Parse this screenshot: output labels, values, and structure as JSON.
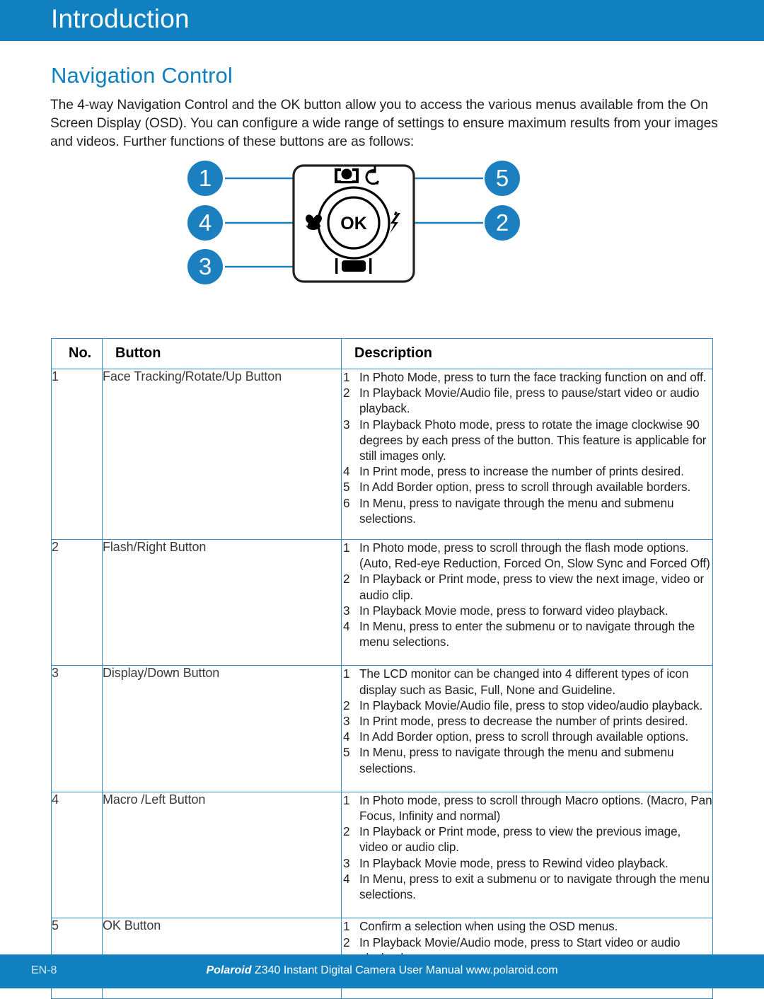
{
  "header": {
    "title": "Introduction",
    "bar_color": "#1180c0"
  },
  "section": {
    "heading": "Navigation Control",
    "heading_color": "#1180c0",
    "paragraph": "The 4-way Navigation Control and the OK button allow you to access the various menus available from the On Screen Display (OSD). You can configure a wide range of settings to ensure maximum results from your images and videos. Further functions of these buttons are as follows:"
  },
  "diagram": {
    "name": "navigation-control-pad-diagram",
    "accent_color": "#1b7fc0",
    "callouts": [
      {
        "label": "1",
        "side": "left",
        "target": "face-tracking-rotate-up-button"
      },
      {
        "label": "4",
        "side": "left",
        "target": "macro-left-button"
      },
      {
        "label": "3",
        "side": "left",
        "target": "display-down-button"
      },
      {
        "label": "5",
        "side": "right",
        "target": "ok-button"
      },
      {
        "label": "2",
        "side": "right",
        "target": "flash-right-button"
      }
    ],
    "pad_icons": {
      "ok": "OK",
      "up": "face-tracking-icon",
      "up_secondary": "self-timer-rotate-icon",
      "left": "macro-flower-icon",
      "right": "flash-bolt-icon",
      "down": "display-screen-icon"
    }
  },
  "table": {
    "columns": [
      "No.",
      "Button",
      "Description"
    ],
    "rows": [
      {
        "no": "1",
        "button": "Face Tracking/Rotate/Up Button",
        "descriptions": [
          "In Photo Mode, press to turn the face tracking function on and off.",
          "In Playback Movie/Audio file, press to pause/start video or audio playback.",
          "In Playback Photo mode, press to rotate the image clockwise 90 degrees by each press of the button. This feature is applicable for still images only.",
          "In Print mode, press to increase the number of prints desired.",
          "In Add Border option, press to scroll through available borders.",
          "In Menu, press to navigate through the menu and submenu selections."
        ]
      },
      {
        "no": "2",
        "button": "Flash/Right Button",
        "descriptions": [
          "In Photo mode, press to scroll through the flash mode options. (Auto, Red-eye Reduction, Forced On, Slow Sync and Forced Off)",
          "In Playback or Print mode, press to view the next image, video or audio clip.",
          "In Playback Movie mode, press to forward video playback.",
          "In Menu, press to enter the submenu or to navigate through the menu selections."
        ]
      },
      {
        "no": "3",
        "button": "Display/Down Button",
        "descriptions": [
          "The LCD monitor can be changed into 4 different types of icon display such as Basic, Full, None and Guideline.",
          "In Playback Movie/Audio file, press to stop video/audio playback.",
          "In Print mode, press to decrease the number of prints desired.",
          "In Add Border option, press to scroll through available options.",
          "In Menu, press to navigate through the menu and submenu selections."
        ]
      },
      {
        "no": "4",
        "button": "Macro /Left Button",
        "descriptions": [
          "In Photo mode, press to scroll through Macro options. (Macro, Pan Focus, Infinity and normal)",
          "In Playback or Print mode, press to view the previous image, video or audio clip.",
          "In Playback Movie mode, press to Rewind video playback.",
          "In Menu, press to exit a submenu or to navigate through the menu selections."
        ]
      },
      {
        "no": "5",
        "button": "OK Button",
        "descriptions": [
          "Confirm a selection when using the OSD menus.",
          "In Playback Movie/Audio mode, press to Start video or audio playback."
        ]
      }
    ]
  },
  "footer": {
    "page_label": "EN-8",
    "brand": "Polaroid",
    "text": " Z340 Instant Digital Camera User Manual www.polaroid.com",
    "bar_color": "#1180c0"
  }
}
